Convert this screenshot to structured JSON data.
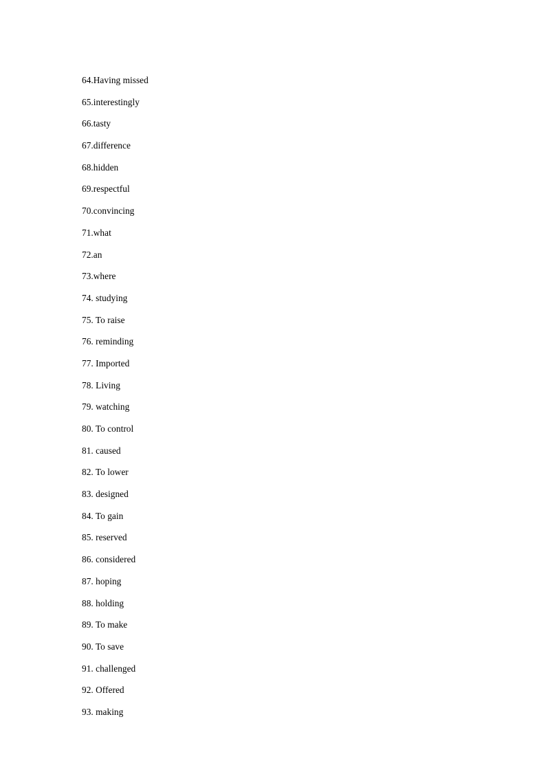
{
  "document": {
    "type": "answer-key",
    "background_color": "#ffffff",
    "text_color": "#000000"
  },
  "answers": {
    "items": [
      {
        "number": "64.",
        "separator": "",
        "answer": "Having missed",
        "text": "64.Having missed"
      },
      {
        "number": "65.",
        "separator": "",
        "answer": "interestingly",
        "text": "65.interestingly"
      },
      {
        "number": "66.",
        "separator": "",
        "answer": "tasty",
        "text": "66.tasty"
      },
      {
        "number": "67.",
        "separator": "",
        "answer": "difference",
        "text": "67.difference"
      },
      {
        "number": "68.",
        "separator": "",
        "answer": "hidden",
        "text": "68.hidden"
      },
      {
        "number": "69.",
        "separator": "",
        "answer": "respectful",
        "text": "69.respectful"
      },
      {
        "number": "70.",
        "separator": "",
        "answer": "convincing",
        "text": "70.convincing"
      },
      {
        "number": "71.",
        "separator": "",
        "answer": "what",
        "text": "71.what"
      },
      {
        "number": "72.",
        "separator": "",
        "answer": "an",
        "text": "72.an"
      },
      {
        "number": "73.",
        "separator": "",
        "answer": "where",
        "text": "73.where"
      },
      {
        "number": "74.",
        "separator": " ",
        "answer": "studying",
        "text": "74. studying"
      },
      {
        "number": "75.",
        "separator": " ",
        "answer": "To raise",
        "text": "75. To raise"
      },
      {
        "number": "76.",
        "separator": " ",
        "answer": "reminding",
        "text": "76. reminding"
      },
      {
        "number": "77.",
        "separator": " ",
        "answer": "Imported",
        "text": "77. Imported"
      },
      {
        "number": "78.",
        "separator": " ",
        "answer": "Living",
        "text": "78. Living"
      },
      {
        "number": "79.",
        "separator": " ",
        "answer": "watching",
        "text": "79. watching"
      },
      {
        "number": "80.",
        "separator": " ",
        "answer": "To control",
        "text": "80. To control"
      },
      {
        "number": "81.",
        "separator": " ",
        "answer": "caused",
        "text": "81. caused"
      },
      {
        "number": "82.",
        "separator": " ",
        "answer": "To lower",
        "text": "82. To lower"
      },
      {
        "number": "83.",
        "separator": " ",
        "answer": "designed",
        "text": "83. designed"
      },
      {
        "number": "84.",
        "separator": " ",
        "answer": "To gain",
        "text": "84. To gain"
      },
      {
        "number": "85.",
        "separator": " ",
        "answer": "reserved",
        "text": "85. reserved"
      },
      {
        "number": "86.",
        "separator": " ",
        "answer": "considered",
        "text": "86. considered"
      },
      {
        "number": "87.",
        "separator": " ",
        "answer": "hoping",
        "text": "87. hoping"
      },
      {
        "number": "88.",
        "separator": " ",
        "answer": "holding",
        "text": "88. holding"
      },
      {
        "number": "89.",
        "separator": " ",
        "answer": "To make",
        "text": "89. To make"
      },
      {
        "number": "90.",
        "separator": " ",
        "answer": "To save",
        "text": "90. To save"
      },
      {
        "number": "91.",
        "separator": " ",
        "answer": "challenged",
        "text": "91. challenged"
      },
      {
        "number": "92.",
        "separator": " ",
        "answer": "Offered",
        "text": "92. Offered"
      },
      {
        "number": "93.",
        "separator": " ",
        "answer": "making",
        "text": "93. making"
      }
    ]
  }
}
